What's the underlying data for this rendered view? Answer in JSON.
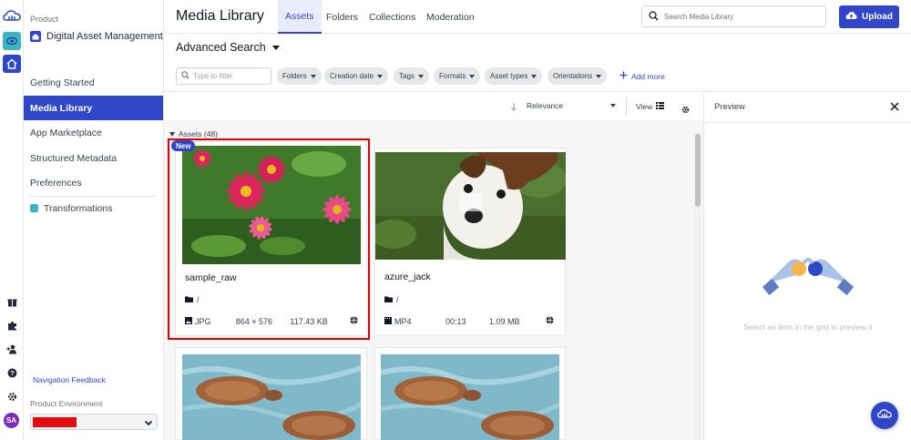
{
  "rail": {
    "avatar_initials": "SA",
    "icons": [
      "cloud-logo-icon",
      "eye-icon",
      "home-icon",
      "gift-icon",
      "puzzle-icon",
      "user-plus-icon",
      "help-icon",
      "settings-icon"
    ]
  },
  "sidebar": {
    "product_label": "Product",
    "product_name": "Digital Asset Management",
    "items": [
      {
        "label": "Getting Started"
      },
      {
        "label": "Media Library",
        "active": true
      },
      {
        "label": "App Marketplace"
      },
      {
        "label": "Structured Metadata"
      },
      {
        "label": "Preferences"
      },
      {
        "label": "Transformations"
      }
    ],
    "navigation_feedback": "Navigation Feedback",
    "product_environment_label": "Product Environment"
  },
  "header": {
    "title": "Media Library",
    "tabs": [
      {
        "label": "Assets",
        "active": true
      },
      {
        "label": "Folders"
      },
      {
        "label": "Collections"
      },
      {
        "label": "Moderation"
      }
    ],
    "search_placeholder": "Search Media Library",
    "upload_label": "Upload"
  },
  "filters": {
    "advanced_search_label": "Advanced Search",
    "filter_placeholder": "Type to filter",
    "chips": [
      "Folders",
      "Creation date",
      "Tags",
      "Formats",
      "Asset types",
      "Orientations"
    ],
    "add_more_label": "Add more"
  },
  "sortbar": {
    "sort_value": "Relevance",
    "view_label": "View"
  },
  "assets": {
    "header_label": "Assets (48)",
    "new_badge": "New",
    "cards": [
      {
        "name": "sample_raw",
        "folder": "/",
        "format": "JPG",
        "dims": "864 × 576",
        "size": "117.43 KB"
      },
      {
        "name": "azure_jack",
        "folder": "/",
        "format": "MP4",
        "dims": "00:13",
        "size": "1.09 MB"
      }
    ]
  },
  "preview": {
    "title": "Preview",
    "hint": "Select an item in the grid to preview it"
  },
  "colors": {
    "accent": "#2f46c9",
    "teal": "#3ab5c6",
    "highlight": "#e00000"
  }
}
